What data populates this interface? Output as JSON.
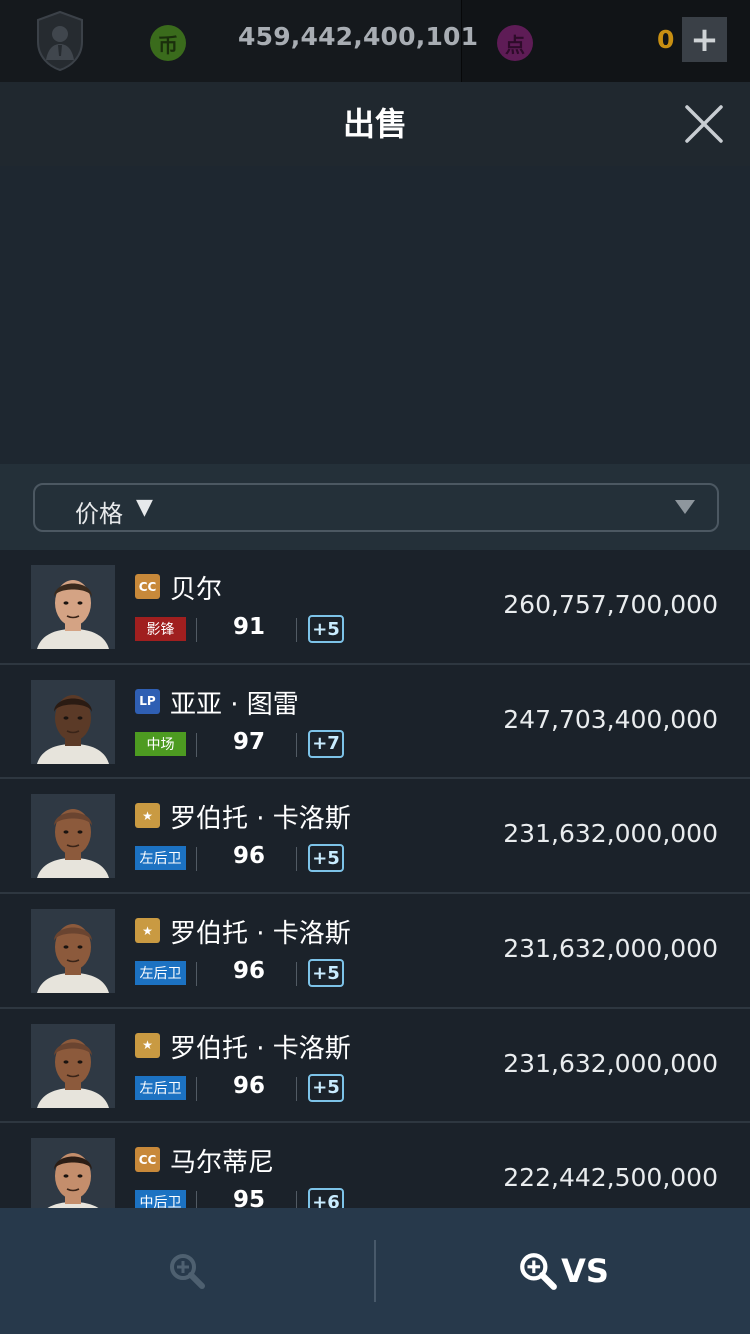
{
  "topbar": {
    "coin_symbol": "币",
    "coin_amount": "459,442,400,101",
    "point_symbol": "点",
    "point_amount": "0",
    "plus_symbol": "+"
  },
  "header": {
    "title": "出售",
    "close_icon": "close-icon"
  },
  "filter": {
    "sort_label": "价格",
    "sort_arrow": "▼"
  },
  "players": [
    {
      "tier": "CC",
      "tier_color": "#c8893a",
      "name": "贝尔",
      "position": "影锋",
      "position_color": "#a01f1f",
      "rating": "91",
      "plus": "+5",
      "price": "260,757,700,000",
      "skin": "#d4a384",
      "hair": "#3a2a1d"
    },
    {
      "tier": "LP",
      "tier_color": "#2f5fb3",
      "name": "亚亚 · 图雷",
      "position": "中场",
      "position_color": "#4d9b21",
      "rating": "97",
      "plus": "+7",
      "price": "247,703,400,000",
      "skin": "#5b3a27",
      "hair": "#2a1b13"
    },
    {
      "tier": "★",
      "tier_color": "#c99a42",
      "name": "罗伯托 · 卡洛斯",
      "position": "左后卫",
      "position_color": "#1c72c2",
      "rating": "96",
      "plus": "+5",
      "price": "231,632,000,000",
      "skin": "#8c5a3c",
      "hair": "#6a4430"
    },
    {
      "tier": "★",
      "tier_color": "#c99a42",
      "name": "罗伯托 · 卡洛斯",
      "position": "左后卫",
      "position_color": "#1c72c2",
      "rating": "96",
      "plus": "+5",
      "price": "231,632,000,000",
      "skin": "#8c5a3c",
      "hair": "#6a4430"
    },
    {
      "tier": "★",
      "tier_color": "#c99a42",
      "name": "罗伯托 · 卡洛斯",
      "position": "左后卫",
      "position_color": "#1c72c2",
      "rating": "96",
      "plus": "+5",
      "price": "231,632,000,000",
      "skin": "#8c5a3c",
      "hair": "#6a4430"
    },
    {
      "tier": "CC",
      "tier_color": "#c8893a",
      "name": "马尔蒂尼",
      "position": "中后卫",
      "position_color": "#1c72c2",
      "rating": "95",
      "plus": "+6",
      "price": "222,442,500,000",
      "skin": "#c48e6c",
      "hair": "#2b1d15"
    }
  ],
  "bottombar": {
    "zoom_icon": "zoom-icon",
    "compare_icon": "zoom-icon",
    "compare_label": "VS"
  }
}
